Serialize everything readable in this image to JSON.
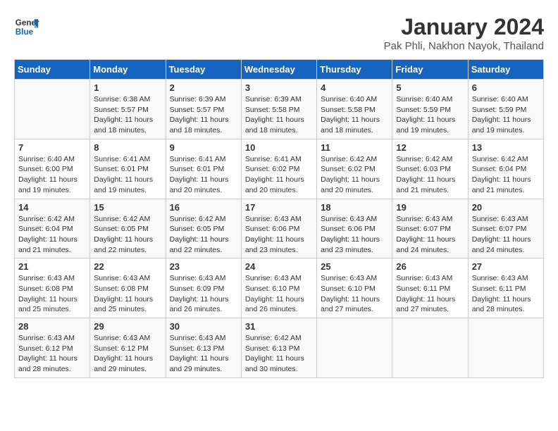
{
  "header": {
    "logo_general": "General",
    "logo_blue": "Blue",
    "month": "January 2024",
    "location": "Pak Phli, Nakhon Nayok, Thailand"
  },
  "weekdays": [
    "Sunday",
    "Monday",
    "Tuesday",
    "Wednesday",
    "Thursday",
    "Friday",
    "Saturday"
  ],
  "weeks": [
    [
      {
        "day": "",
        "sunrise": "",
        "sunset": "",
        "daylight": ""
      },
      {
        "day": "1",
        "sunrise": "Sunrise: 6:38 AM",
        "sunset": "Sunset: 5:57 PM",
        "daylight": "Daylight: 11 hours and 18 minutes."
      },
      {
        "day": "2",
        "sunrise": "Sunrise: 6:39 AM",
        "sunset": "Sunset: 5:57 PM",
        "daylight": "Daylight: 11 hours and 18 minutes."
      },
      {
        "day": "3",
        "sunrise": "Sunrise: 6:39 AM",
        "sunset": "Sunset: 5:58 PM",
        "daylight": "Daylight: 11 hours and 18 minutes."
      },
      {
        "day": "4",
        "sunrise": "Sunrise: 6:40 AM",
        "sunset": "Sunset: 5:58 PM",
        "daylight": "Daylight: 11 hours and 18 minutes."
      },
      {
        "day": "5",
        "sunrise": "Sunrise: 6:40 AM",
        "sunset": "Sunset: 5:59 PM",
        "daylight": "Daylight: 11 hours and 19 minutes."
      },
      {
        "day": "6",
        "sunrise": "Sunrise: 6:40 AM",
        "sunset": "Sunset: 5:59 PM",
        "daylight": "Daylight: 11 hours and 19 minutes."
      }
    ],
    [
      {
        "day": "7",
        "sunrise": "Sunrise: 6:40 AM",
        "sunset": "Sunset: 6:00 PM",
        "daylight": "Daylight: 11 hours and 19 minutes."
      },
      {
        "day": "8",
        "sunrise": "Sunrise: 6:41 AM",
        "sunset": "Sunset: 6:01 PM",
        "daylight": "Daylight: 11 hours and 19 minutes."
      },
      {
        "day": "9",
        "sunrise": "Sunrise: 6:41 AM",
        "sunset": "Sunset: 6:01 PM",
        "daylight": "Daylight: 11 hours and 20 minutes."
      },
      {
        "day": "10",
        "sunrise": "Sunrise: 6:41 AM",
        "sunset": "Sunset: 6:02 PM",
        "daylight": "Daylight: 11 hours and 20 minutes."
      },
      {
        "day": "11",
        "sunrise": "Sunrise: 6:42 AM",
        "sunset": "Sunset: 6:02 PM",
        "daylight": "Daylight: 11 hours and 20 minutes."
      },
      {
        "day": "12",
        "sunrise": "Sunrise: 6:42 AM",
        "sunset": "Sunset: 6:03 PM",
        "daylight": "Daylight: 11 hours and 21 minutes."
      },
      {
        "day": "13",
        "sunrise": "Sunrise: 6:42 AM",
        "sunset": "Sunset: 6:04 PM",
        "daylight": "Daylight: 11 hours and 21 minutes."
      }
    ],
    [
      {
        "day": "14",
        "sunrise": "Sunrise: 6:42 AM",
        "sunset": "Sunset: 6:04 PM",
        "daylight": "Daylight: 11 hours and 21 minutes."
      },
      {
        "day": "15",
        "sunrise": "Sunrise: 6:42 AM",
        "sunset": "Sunset: 6:05 PM",
        "daylight": "Daylight: 11 hours and 22 minutes."
      },
      {
        "day": "16",
        "sunrise": "Sunrise: 6:42 AM",
        "sunset": "Sunset: 6:05 PM",
        "daylight": "Daylight: 11 hours and 22 minutes."
      },
      {
        "day": "17",
        "sunrise": "Sunrise: 6:43 AM",
        "sunset": "Sunset: 6:06 PM",
        "daylight": "Daylight: 11 hours and 23 minutes."
      },
      {
        "day": "18",
        "sunrise": "Sunrise: 6:43 AM",
        "sunset": "Sunset: 6:06 PM",
        "daylight": "Daylight: 11 hours and 23 minutes."
      },
      {
        "day": "19",
        "sunrise": "Sunrise: 6:43 AM",
        "sunset": "Sunset: 6:07 PM",
        "daylight": "Daylight: 11 hours and 24 minutes."
      },
      {
        "day": "20",
        "sunrise": "Sunrise: 6:43 AM",
        "sunset": "Sunset: 6:07 PM",
        "daylight": "Daylight: 11 hours and 24 minutes."
      }
    ],
    [
      {
        "day": "21",
        "sunrise": "Sunrise: 6:43 AM",
        "sunset": "Sunset: 6:08 PM",
        "daylight": "Daylight: 11 hours and 25 minutes."
      },
      {
        "day": "22",
        "sunrise": "Sunrise: 6:43 AM",
        "sunset": "Sunset: 6:08 PM",
        "daylight": "Daylight: 11 hours and 25 minutes."
      },
      {
        "day": "23",
        "sunrise": "Sunrise: 6:43 AM",
        "sunset": "Sunset: 6:09 PM",
        "daylight": "Daylight: 11 hours and 26 minutes."
      },
      {
        "day": "24",
        "sunrise": "Sunrise: 6:43 AM",
        "sunset": "Sunset: 6:10 PM",
        "daylight": "Daylight: 11 hours and 26 minutes."
      },
      {
        "day": "25",
        "sunrise": "Sunrise: 6:43 AM",
        "sunset": "Sunset: 6:10 PM",
        "daylight": "Daylight: 11 hours and 27 minutes."
      },
      {
        "day": "26",
        "sunrise": "Sunrise: 6:43 AM",
        "sunset": "Sunset: 6:11 PM",
        "daylight": "Daylight: 11 hours and 27 minutes."
      },
      {
        "day": "27",
        "sunrise": "Sunrise: 6:43 AM",
        "sunset": "Sunset: 6:11 PM",
        "daylight": "Daylight: 11 hours and 28 minutes."
      }
    ],
    [
      {
        "day": "28",
        "sunrise": "Sunrise: 6:43 AM",
        "sunset": "Sunset: 6:12 PM",
        "daylight": "Daylight: 11 hours and 28 minutes."
      },
      {
        "day": "29",
        "sunrise": "Sunrise: 6:43 AM",
        "sunset": "Sunset: 6:12 PM",
        "daylight": "Daylight: 11 hours and 29 minutes."
      },
      {
        "day": "30",
        "sunrise": "Sunrise: 6:43 AM",
        "sunset": "Sunset: 6:13 PM",
        "daylight": "Daylight: 11 hours and 29 minutes."
      },
      {
        "day": "31",
        "sunrise": "Sunrise: 6:42 AM",
        "sunset": "Sunset: 6:13 PM",
        "daylight": "Daylight: 11 hours and 30 minutes."
      },
      {
        "day": "",
        "sunrise": "",
        "sunset": "",
        "daylight": ""
      },
      {
        "day": "",
        "sunrise": "",
        "sunset": "",
        "daylight": ""
      },
      {
        "day": "",
        "sunrise": "",
        "sunset": "",
        "daylight": ""
      }
    ]
  ]
}
